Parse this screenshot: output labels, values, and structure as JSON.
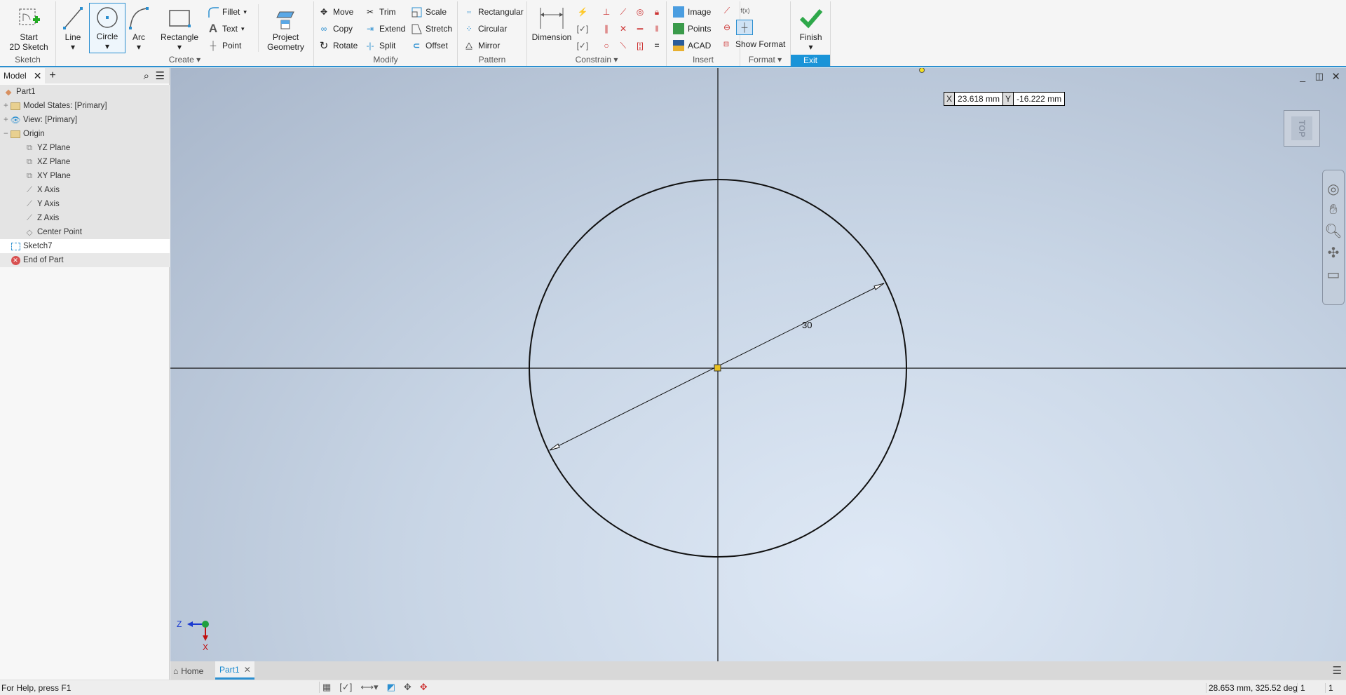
{
  "ribbon": {
    "sketch": {
      "label": "Sketch",
      "start": "Start",
      "start2": "2D Sketch"
    },
    "create": {
      "label": "Create",
      "line": "Line",
      "circle": "Circle",
      "arc": "Arc",
      "rectangle": "Rectangle",
      "fillet": "Fillet",
      "text": "Text",
      "point": "Point",
      "project": "Project",
      "project2": "Geometry"
    },
    "modify": {
      "label": "Modify",
      "move": "Move",
      "copy": "Copy",
      "rotate": "Rotate",
      "trim": "Trim",
      "extend": "Extend",
      "split": "Split",
      "scale": "Scale",
      "stretch": "Stretch",
      "offset": "Offset"
    },
    "pattern": {
      "label": "Pattern",
      "rectangular": "Rectangular",
      "circular": "Circular",
      "mirror": "Mirror"
    },
    "constrain": {
      "label": "Constrain",
      "dimension": "Dimension"
    },
    "insert": {
      "label": "Insert",
      "image": "Image",
      "points": "Points",
      "acad": "ACAD"
    },
    "format": {
      "label": "Format",
      "show_format": "Show Format"
    },
    "exit": {
      "label": "Exit",
      "finish": "Finish"
    },
    "accent": "#2b8fd0"
  },
  "browser": {
    "tab": "Model",
    "items": [
      {
        "label": "Part1",
        "icon": "part-icon"
      },
      {
        "label": "Model States: [Primary]",
        "icon": "folder-icon"
      },
      {
        "label": "View: [Primary]",
        "icon": "view-icon"
      },
      {
        "label": "Origin",
        "icon": "origin-folder-icon"
      },
      {
        "label": "YZ Plane",
        "icon": "plane-icon"
      },
      {
        "label": "XZ Plane",
        "icon": "plane-icon"
      },
      {
        "label": "XY Plane",
        "icon": "plane-icon"
      },
      {
        "label": "X Axis",
        "icon": "axis-icon"
      },
      {
        "label": "Y Axis",
        "icon": "axis-icon"
      },
      {
        "label": "Z Axis",
        "icon": "axis-icon"
      },
      {
        "label": "Center Point",
        "icon": "point-icon"
      },
      {
        "label": "Sketch7",
        "icon": "sketch-icon"
      },
      {
        "label": "End of Part",
        "icon": "end-of-part-icon"
      }
    ]
  },
  "viewport": {
    "coord_x_label": "X",
    "coord_x": "23.618 mm",
    "coord_y_label": "Y",
    "coord_y": "-16.222 mm",
    "viewcube": "TOP",
    "dimension": "30",
    "triad_z": "Z",
    "triad_x": "X"
  },
  "tabs": {
    "home": "Home",
    "part": "Part1"
  },
  "status": {
    "help": "For Help, press F1",
    "readout": "28.653 mm, 325.52 deg",
    "field1": "1",
    "field2": "1"
  }
}
